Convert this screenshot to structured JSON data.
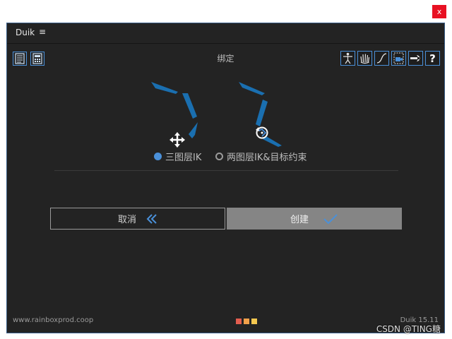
{
  "window": {
    "close_label": "x"
  },
  "menu": {
    "title": "Duik",
    "menu_icon": "hamburger-icon",
    "menu_glyph": "≡"
  },
  "panel": {
    "title": "绑定"
  },
  "toolbar_left": [
    {
      "icon": "document-icon"
    },
    {
      "icon": "calculator-icon"
    }
  ],
  "toolbar_right": [
    {
      "icon": "rig-person-icon"
    },
    {
      "icon": "hand-icon"
    },
    {
      "icon": "curve-icon"
    },
    {
      "icon": "camera-icon"
    },
    {
      "icon": "wrench-icon"
    },
    {
      "icon": "help-icon",
      "glyph": "?"
    }
  ],
  "options": {
    "three_layer": {
      "label": "三图层IK",
      "selected": true
    },
    "two_layer": {
      "label": "两图层IK&目标约束",
      "selected": false
    }
  },
  "buttons": {
    "cancel": "取消",
    "create": "创建"
  },
  "footer": {
    "website": "www.rainboxprod.coop",
    "version": "Duik 15.11",
    "dot_colors": [
      "#e35d4f",
      "#f2a14a",
      "#f5c850"
    ]
  },
  "watermark": "CSDN @TING糖",
  "colors": {
    "accent": "#4a90d9",
    "limb_blue": "#1a6fb0",
    "window_bg": "#232323"
  }
}
